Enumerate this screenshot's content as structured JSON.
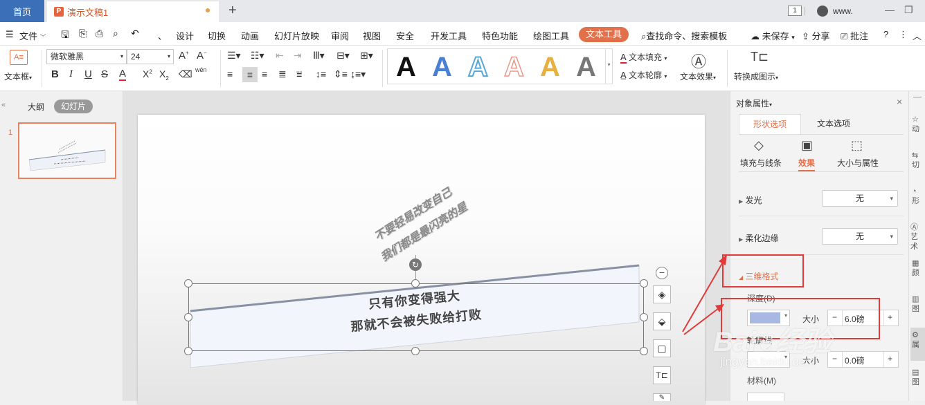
{
  "titlebar": {
    "home_tab": "首页",
    "doc_tab": "演示文稿1",
    "doc_icon": "P",
    "page_badge": "1",
    "user_name": "www.",
    "new_tab": "+"
  },
  "menubar": {
    "file": "文件",
    "items": [
      "设计",
      "切换",
      "动画",
      "幻灯片放映",
      "审阅",
      "视图",
      "安全",
      "开发工具",
      "特色功能",
      "绘图工具"
    ],
    "active": "文本工具",
    "search": "查找命令、搜索模板",
    "unsaved": "未保存",
    "share": "分享",
    "comment": "批注"
  },
  "ribbon": {
    "textbox_label": "文本框",
    "font_name": "微软雅黑",
    "font_size": "24",
    "text_fill": "文本填充",
    "text_outline": "文本轮廓",
    "text_effect": "文本效果",
    "convert": "转换成图示",
    "wen": "wén"
  },
  "leftpanel": {
    "outline_tab": "大纲",
    "slides_tab": "幻灯片",
    "slide_number": "1"
  },
  "slide": {
    "rotated_line1": "不要轻易改变自己",
    "rotated_line2": "我们都是最闪亮的星",
    "box_line1": "只有你变得强大",
    "box_line2": "那就不会被失败给打败"
  },
  "rightpanel": {
    "title": "对象属性",
    "tab_shape": "形状选项",
    "tab_text": "文本选项",
    "sub_fill": "填充与线条",
    "sub_effect": "效果",
    "sub_size": "大小与属性",
    "glow_label": "发光",
    "glow_value": "无",
    "soft_label": "柔化边缘",
    "soft_value": "无",
    "format3d_label": "三维格式",
    "depth_label": "深度(D)",
    "size_label": "大小",
    "depth_size": "6.0磅",
    "contour_label": "轮廓线",
    "contour_size": "0.0磅",
    "material_label": "材料(M)"
  },
  "sidebar": {
    "items": [
      "动",
      "切",
      "形",
      "艺术",
      "颜",
      "图",
      "属",
      "图"
    ]
  },
  "watermark": {
    "brand": "Bai",
    "brand2": "经验",
    "url": "jingyan.baidu.com"
  },
  "colors": {
    "accent": "#e2704a",
    "home_tab": "#3b6fb8",
    "annotation": "#e03a3a",
    "depth_color": "#a9b8e2"
  }
}
